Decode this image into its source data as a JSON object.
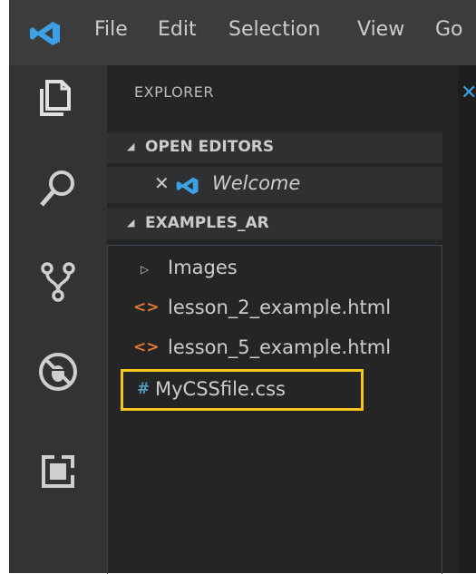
{
  "titlebar": {
    "menu": [
      "File",
      "Edit",
      "Selection",
      "View",
      "Go"
    ]
  },
  "activity_bar": {
    "icons": [
      "explorer-icon",
      "search-icon",
      "source-control-icon",
      "debug-icon",
      "extensions-icon"
    ]
  },
  "sidebar": {
    "title": "EXPLORER",
    "open_editors": {
      "header": "OPEN EDITORS",
      "items": [
        {
          "label": "Welcome",
          "icon": "vscode-logo-icon"
        }
      ]
    },
    "folder": {
      "header": "EXAMPLES_AR",
      "items": [
        {
          "label": "Images",
          "icon": "chevron-right-icon",
          "type": "folder"
        },
        {
          "label": "lesson_2_example.html",
          "icon": "html-file-icon",
          "type": "file"
        },
        {
          "label": "lesson_5_example.html",
          "icon": "html-file-icon",
          "type": "file"
        },
        {
          "label": "MyCSSfile.css",
          "icon": "css-file-icon",
          "type": "file"
        }
      ]
    }
  },
  "colors": {
    "highlight": "#f5c518",
    "vscode_blue": "#3ba0e6",
    "html_icon": "#e37933",
    "css_icon": "#519aba"
  }
}
